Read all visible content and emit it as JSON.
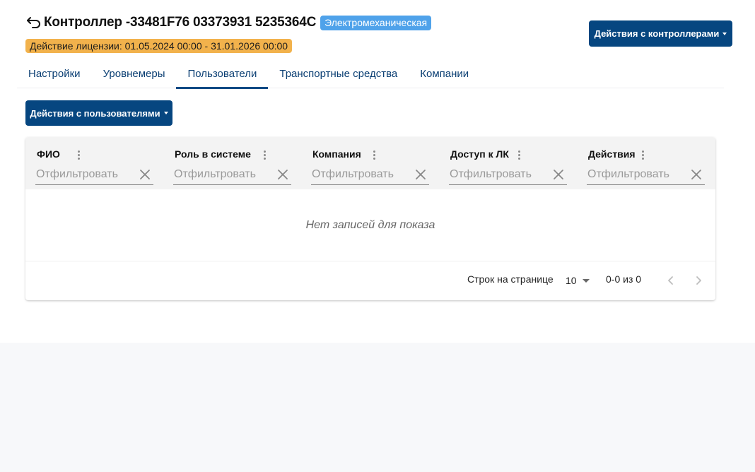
{
  "header": {
    "back_icon": "arrow-back-icon",
    "title": "Контроллер -33481F76 03373931 5235364C",
    "type_badge": "Электромеханическая",
    "license": "Действие лицензии: 01.05.2024 00:00 - 31.01.2026 00:00",
    "controllers_actions_label": "Действия с контроллерами"
  },
  "tabs": [
    {
      "label": "Настройки",
      "active": false
    },
    {
      "label": "Уровнемеры",
      "active": false
    },
    {
      "label": "Пользователи",
      "active": true
    },
    {
      "label": "Транспортные средства",
      "active": false
    },
    {
      "label": "Компании",
      "active": false
    }
  ],
  "users_actions_label": "Действия с пользователями",
  "grid": {
    "columns": [
      {
        "title": "ФИО",
        "filter_placeholder": "Отфильтровать"
      },
      {
        "title": "Роль в системе",
        "filter_placeholder": "Отфильтровать"
      },
      {
        "title": "Компания",
        "filter_placeholder": "Отфильтровать"
      },
      {
        "title": "Доступ к ЛК",
        "filter_placeholder": "Отфильтровать"
      },
      {
        "title": "Действия",
        "filter_placeholder": "Отфильтровать"
      }
    ],
    "empty_message": "Нет записей для показа",
    "footer": {
      "rows_per_page_label": "Строк на странице",
      "rows_per_page_value": "10",
      "range": "0-0 из 0"
    }
  },
  "colors": {
    "primary": "#064680",
    "type_badge": "#4fa2ea",
    "license_badge": "#f2b24c",
    "tab_text": "#0b3f73"
  }
}
